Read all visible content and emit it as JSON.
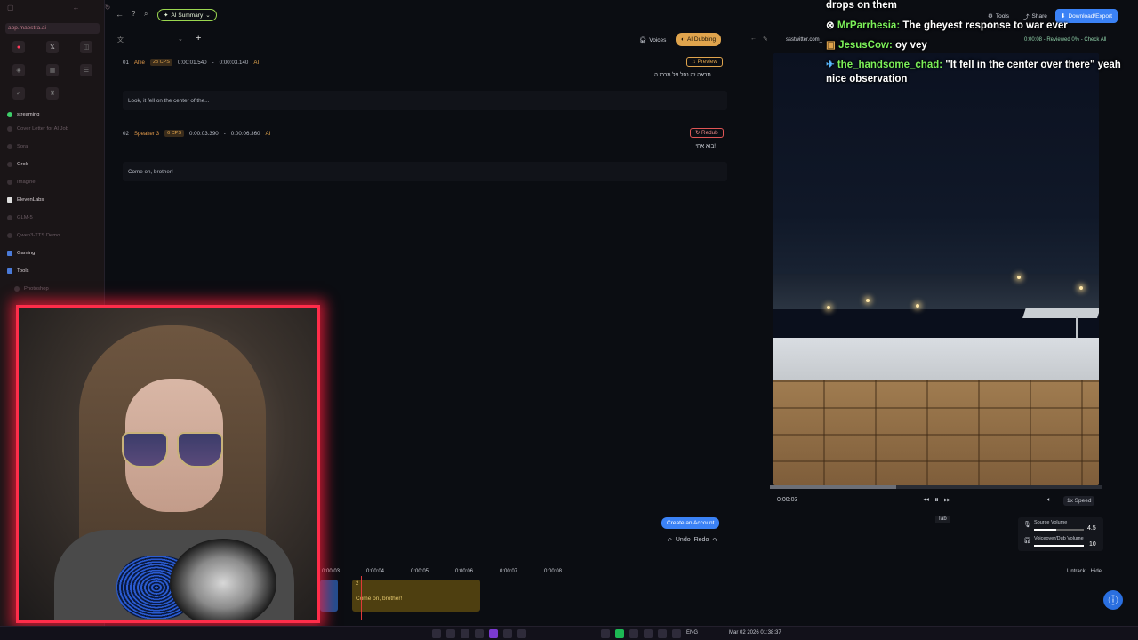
{
  "browser": {
    "url": "app.maestra.ai"
  },
  "sidebar": {
    "items": [
      {
        "label": "streaming",
        "bright": true,
        "color": "#3ecf6a"
      },
      {
        "label": "Cover Letter for AI Job"
      },
      {
        "label": "Sora"
      },
      {
        "label": "Grok",
        "bright": true
      },
      {
        "label": "Imagine"
      },
      {
        "label": "ElevenLabs",
        "bright": true
      },
      {
        "label": "GLM-5"
      },
      {
        "label": "Qwen3-TTS Demo"
      },
      {
        "label": "Gaming",
        "bright": true
      },
      {
        "label": "Tools",
        "bright": true
      },
      {
        "label": "Photoshop"
      }
    ]
  },
  "topbar": {
    "ai_summary": "AI Summary",
    "tools": "Tools",
    "share": "Share",
    "download": "Download/Export"
  },
  "editor_toolbar": {
    "voices": "Voices",
    "ai_dubbing": "AI Dubbing"
  },
  "segments": [
    {
      "index": "01",
      "speaker": "Alfie",
      "cps": "23 CPS",
      "start": "0:00:01.540",
      "end": "0:00:03.140",
      "ai_tag": "AI",
      "action": "Preview",
      "source_text": "תראה זה נפל על מרכז ה...",
      "translation": "Look, it fell on the center of the..."
    },
    {
      "index": "02",
      "speaker": "Speaker 3",
      "cps": "6 CPS",
      "start": "0:00:03.390",
      "end": "0:00:06.360",
      "ai_tag": "AI",
      "action": "Redub",
      "source_text": "בוא אחי!",
      "translation": "Come on, brother!"
    }
  ],
  "editor_footer": {
    "create_account": "Create an Account",
    "undo": "Undo",
    "redo": "Redo"
  },
  "video": {
    "source_label": "ssstwitter.com_",
    "status": "0:00:08 - Reviewed 0% - Check All",
    "current_time": "0:00:03",
    "progress": 0.38,
    "tooltip": "Tab",
    "speed": "1x Speed",
    "source_volume_label": "Source Volume",
    "source_volume": "4.5",
    "dub_volume_label": "Voiceover/Dub Volume",
    "dub_volume": "10"
  },
  "chat": [
    {
      "user": "",
      "message": "drops on them"
    },
    {
      "user": "MrParrhesia:",
      "message": "The gheyest response to war ever",
      "color": "#7cf15a"
    },
    {
      "user": "JesusCow:",
      "message": "oy vey",
      "color": "#7cf15a"
    },
    {
      "user": "the_handsome_chad:",
      "message": "\"It fell in the center over there\" yeah nice observation",
      "color": "#7cf15a"
    }
  ],
  "timeline": {
    "ticks": [
      "0:00:03",
      "0:00:04",
      "0:00:05",
      "0:00:06",
      "0:00:07",
      "0:00:08"
    ],
    "clip_index": "2",
    "clip_text": "Come on, brother!",
    "untrack": "Untrack",
    "hide": "Hide"
  },
  "taskbar": {
    "lang": "ENG",
    "datetime": "Mar 02 2026 01:38:37"
  }
}
